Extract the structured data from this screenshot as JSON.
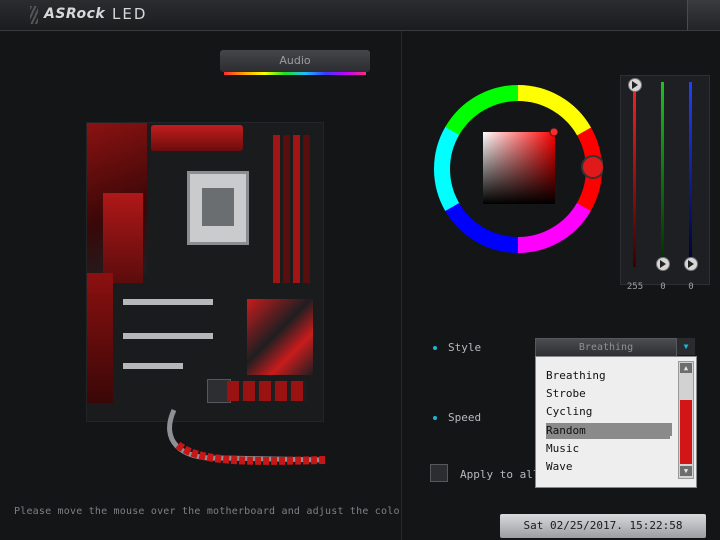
{
  "app": {
    "brand": "ASRock",
    "title": "LED"
  },
  "audio_button": {
    "label": "Audio"
  },
  "hint_text": "Please move the mouse over the motherboard and adjust the color.",
  "rgb": {
    "red": "255",
    "green": "0",
    "blue": "0"
  },
  "style": {
    "label": "Style",
    "selected": "Breathing",
    "options": [
      "Breathing",
      "Strobe",
      "Cycling",
      "Random",
      "Music",
      "Wave"
    ],
    "highlighted": "Random"
  },
  "speed": {
    "label": "Speed"
  },
  "apply_all": {
    "label": "Apply to all"
  },
  "datetime": "Sat 02/25/2017. 15:22:58",
  "colors": {
    "accent": "#1bb6d4",
    "selected_color": "#ff0000"
  }
}
